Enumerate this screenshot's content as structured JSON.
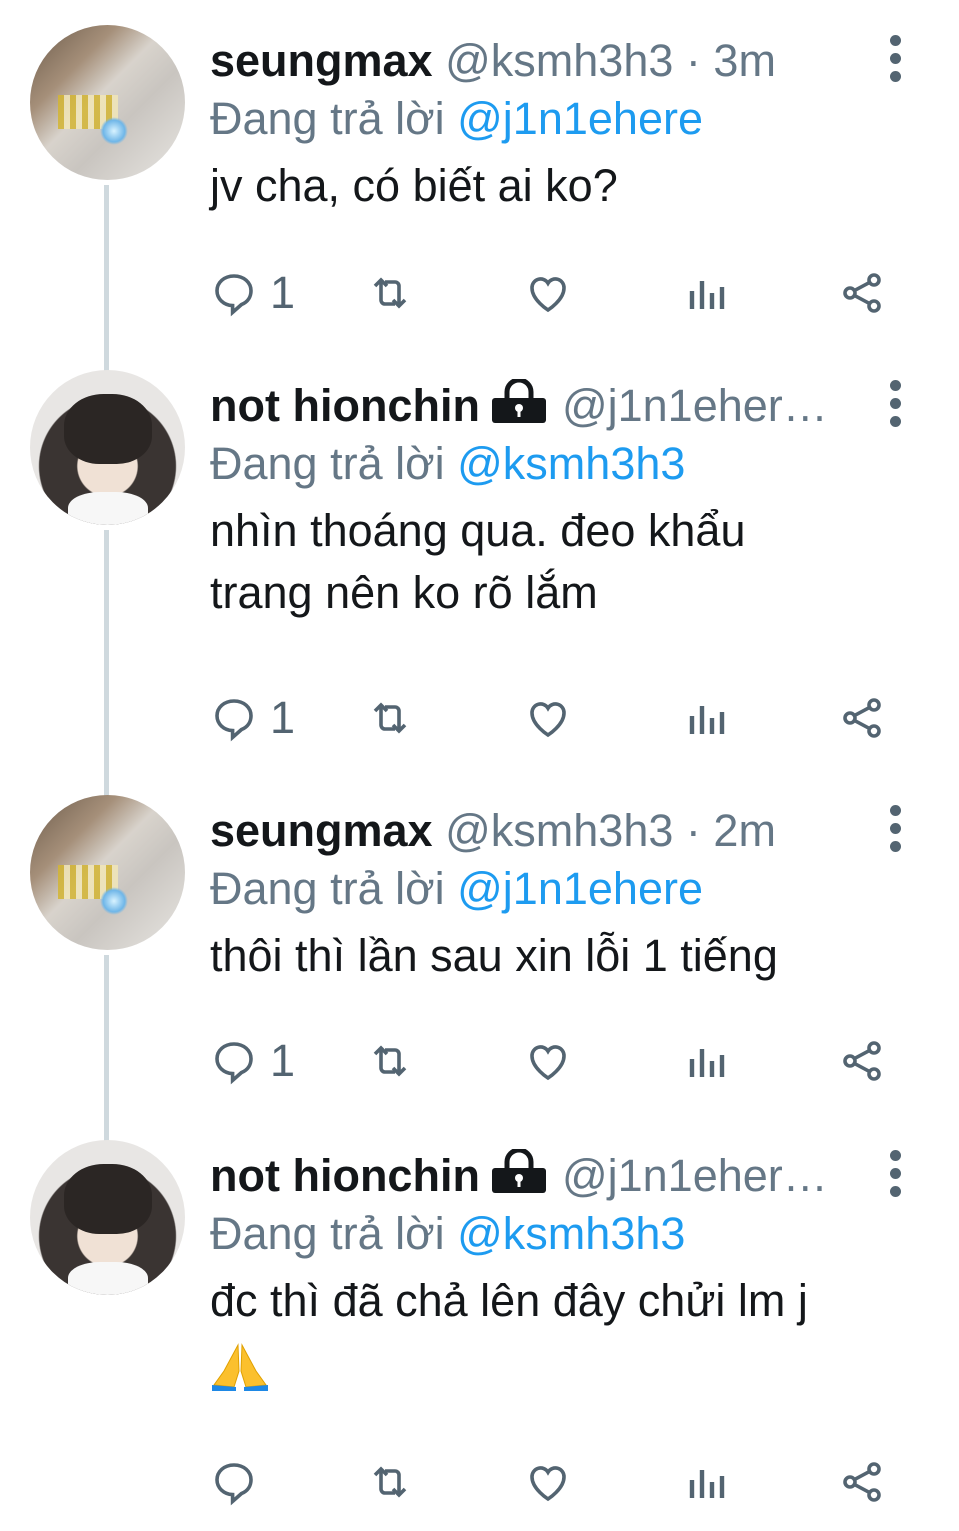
{
  "tweets": [
    {
      "name": "seungmax",
      "handle": "@ksmh3h3",
      "separator": "·",
      "time": "3m",
      "locked": false,
      "reply_prefix": "Đang trả lời",
      "reply_to": "@j1n1ehere",
      "text": "jv cha, có biết ai ko?",
      "reply_count": "1"
    },
    {
      "name": "not hionchin",
      "handle": "@j1n1eher…",
      "separator": "",
      "time": "",
      "locked": true,
      "reply_prefix": "Đang trả lời",
      "reply_to": "@ksmh3h3",
      "text_lines": [
        "nhìn thoáng qua. đeo khẩu",
        "trang nên ko rõ lắm"
      ],
      "reply_count": "1"
    },
    {
      "name": "seungmax",
      "handle": "@ksmh3h3",
      "separator": "·",
      "time": "2m",
      "locked": false,
      "reply_prefix": "Đang trả lời",
      "reply_to": "@j1n1ehere",
      "text": "thôi thì lần sau xin lỗi 1 tiếng",
      "reply_count": "1"
    },
    {
      "name": "not hionchin",
      "handle": "@j1n1eher…",
      "separator": "",
      "time": "",
      "locked": true,
      "reply_prefix": "Đang trả lời",
      "reply_to": "@ksmh3h3",
      "text": "đc thì đã chả lên đây chửi lm j",
      "emoji": "folded-hands-emoji",
      "reply_count": ""
    }
  ],
  "icons": {
    "reply": "reply-icon",
    "retweet": "retweet-icon",
    "like": "heart-icon",
    "views": "analytics-icon",
    "share": "share-icon",
    "more": "more-vertical-icon",
    "lock": "lock-icon"
  },
  "colors": {
    "mention": "#1d9bf0",
    "secondary": "#657786",
    "thread_line": "#cfd9de"
  }
}
